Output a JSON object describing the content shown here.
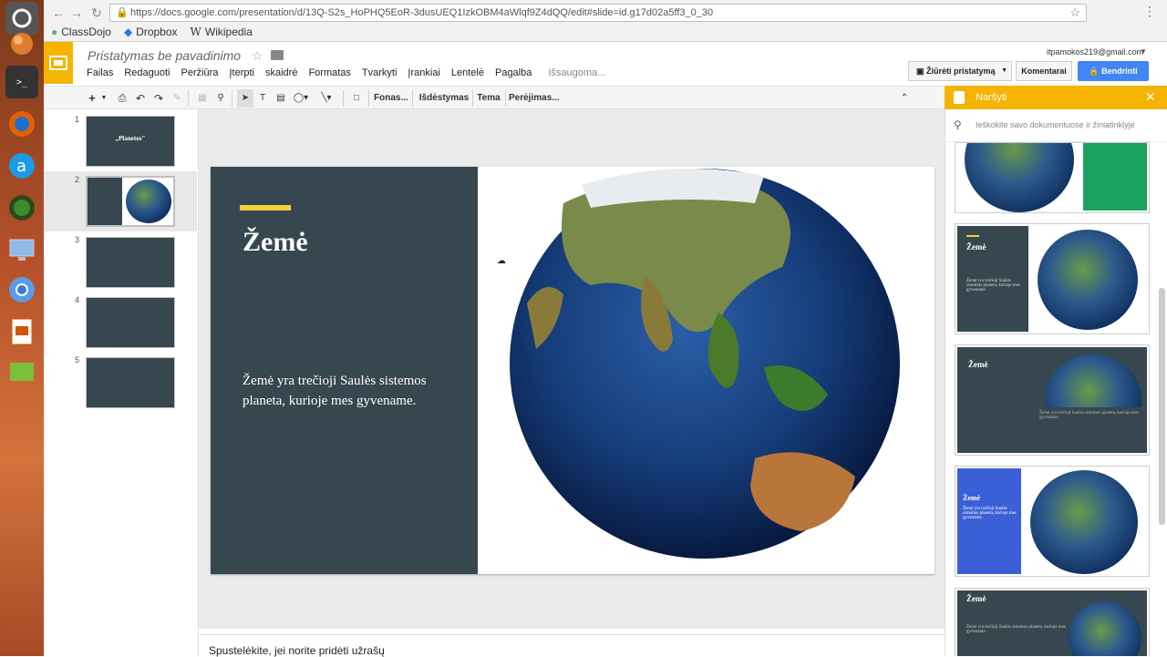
{
  "browser": {
    "url": "https://docs.google.com/presentation/d/13Q-S2s_HoPHQ5EoR-3dusUEQ1IzkOBM4aWlqf9Z4dQQ/edit#slide=id.g17d02a5ff3_0_30",
    "bookmarks": [
      "ClassDojo",
      "Dropbox",
      "Wikipedia"
    ]
  },
  "doc": {
    "title": "Pristatymas be pavadinimo",
    "status": "Išsaugoma...",
    "account": "itpamokos219@gmail.com",
    "present_label": "Žiūrėti pristatymą",
    "comments_label": "Komentarai",
    "share_label": "Bendrinti",
    "menu": [
      "Failas",
      "Redaguoti",
      "Peržiūra",
      "Įterpti",
      "skaidrė",
      "Formatas",
      "Tvarkyti",
      "Įrankiai",
      "Lentelė",
      "Pagalba"
    ]
  },
  "toolbar": {
    "background": "Fonas...",
    "layout": "Išdėstymas",
    "theme": "Tema",
    "transition": "Perėjimas..."
  },
  "filmstrip": {
    "numbers": [
      "1",
      "2",
      "3",
      "4",
      "5"
    ],
    "slide1_title": "„Planetos\"",
    "slide1_sub": "..."
  },
  "slide": {
    "title": "Žemė",
    "body": "Žemė yra trečioji Saulės sistemos planeta, kurioje mes gyvename."
  },
  "notes": {
    "placeholder": "Spustelėkite, jei norite pridėti užrašų"
  },
  "explore": {
    "title": "Naršyti",
    "search_placeholder": "Ieškokite savo dokumentuose ir žiniatinklyje",
    "card_title": "Žemė",
    "card_body": "Žemė yra trečioji Saulės sistemos planeta, kurioje mes gyvename."
  },
  "colors": {
    "slide_dark": "#37474f",
    "accent_yellow": "#f4d03f",
    "docs_yellow": "#f4b400",
    "share_blue": "#4285f4",
    "green": "#1aa260",
    "blue_card": "#3b5fd6"
  }
}
